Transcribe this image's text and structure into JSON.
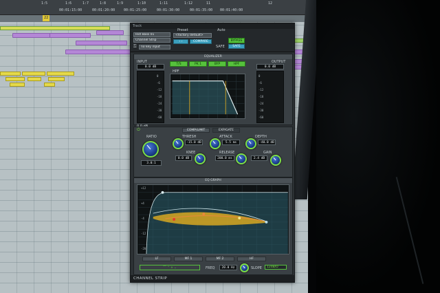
{
  "timeline": {
    "ruler_labels": [
      "1:5",
      "1:6",
      "1:7",
      "1:8",
      "1:9",
      "1:10",
      "1:11",
      "1:12",
      "11",
      "12"
    ],
    "timecodes": [
      "00:01:15:00",
      "00:01:20:00",
      "00:01:25:00",
      "00:01:30:00",
      "00:01:35:00",
      "00:01:40:00"
    ],
    "markers": [
      "22"
    ]
  },
  "plugin": {
    "window_title": "Track",
    "preset_label": "Preset",
    "auto_label": "Auto",
    "track_select": "Inst Bass 01",
    "channel_select": "Channel Strip",
    "factory_default": "<factory default>",
    "bypass_label": "BYPASS",
    "safe_label": "SAFE",
    "compare_label": "COMPARE",
    "no_key_input": "no key input",
    "input_label": "INPUT",
    "output_label": "OUTPUT",
    "input_value": "0.0 dB",
    "output_value": "0.0 dB",
    "eq_section_label": "EQUALIZER",
    "eq_buttons": [
      "T/S",
      "PK 1",
      "BYP",
      "HPF"
    ],
    "filter_label": "HPF",
    "dyn_tabs": [
      "COMP/LIMIT",
      "EXP/GATE"
    ],
    "ratio_label": "RATIO",
    "ratio_value": "3.0:1",
    "thresh_label": "THRESH",
    "thresh_value": "-15.0 dB",
    "attack_label": "ATTACK",
    "attack_value": "5.5 ms",
    "depth_label": "DEPTH",
    "depth_value": "-40.0 dB",
    "knee_label": "KNEE",
    "knee_value": "0.0 dB",
    "release_label": "RELEASE",
    "release_value": "200.0 ms",
    "gain_label": "GAIN",
    "gain_value": "2.4 dB",
    "eq_graph_label": "EQ GRAPH",
    "freq_label": "FREQ",
    "freq_value": "20.0 Hz",
    "slope_label": "SLOPE",
    "slope_value": "12dB/O",
    "band_labels": [
      "LF",
      "MF 1",
      "MF 2",
      "HF"
    ],
    "footer": "CHANNEL STRIP",
    "meter_scale": [
      "0",
      "-3",
      "-6",
      "-9",
      "-12",
      "-15",
      "-18",
      "-24",
      "-30",
      "-40",
      "-60"
    ],
    "graph_scale": [
      "+12",
      "+8",
      "+4",
      "0",
      "-4",
      "-8",
      "-12",
      "-16",
      "-20"
    ]
  },
  "colors": {
    "accent_green": "#56c23c",
    "accent_blue": "#3b9fbd",
    "panel": "#2c3134",
    "eq_curve": "#f0b51c"
  }
}
